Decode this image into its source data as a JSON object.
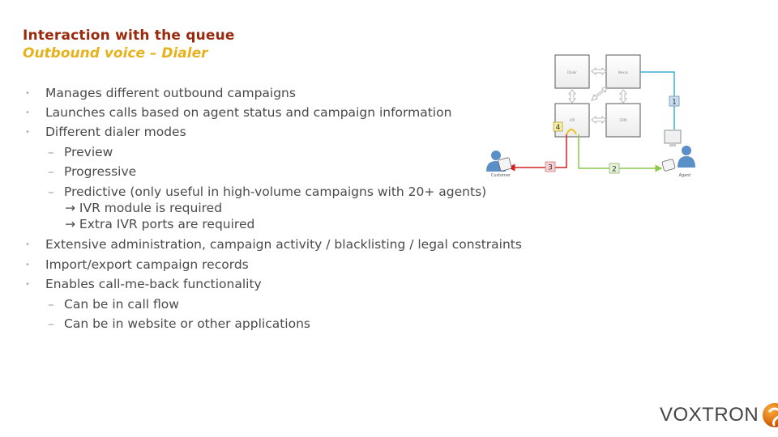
{
  "slide": {
    "title": "Interaction with the queue",
    "subtitle": "Outbound voice – Dialer"
  },
  "bullets": [
    {
      "level": 1,
      "text": "Manages different outbound campaigns"
    },
    {
      "level": 1,
      "text": "Launches calls based on agent status and campaign information"
    },
    {
      "level": 1,
      "text": "Different dialer modes"
    },
    {
      "level": 2,
      "text": "Preview"
    },
    {
      "level": 2,
      "text": "Progressive"
    },
    {
      "level": 2,
      "text": "Predictive (only useful in high-volume campaigns with 20+ agents)"
    },
    {
      "level": 3,
      "text": "→ IVR module is required"
    },
    {
      "level": 3,
      "text": "→ Extra IVR ports are required"
    },
    {
      "level": 1,
      "text": "Extensive administration, campaign activity  / blacklisting / legal constraints"
    },
    {
      "level": 1,
      "text": "Import/export campaign records"
    },
    {
      "level": 1,
      "text": "Enables call-me-back functionality"
    },
    {
      "level": 2,
      "text": "Can be in call flow"
    },
    {
      "level": 2,
      "text": "Can be in website or other applications"
    }
  ],
  "bullet_glyph": "•",
  "dash_glyph": "–",
  "diagram": {
    "boxes": [
      "Dialer",
      "Nexus",
      "IVR",
      "CRM"
    ],
    "steps": [
      "1",
      "2",
      "3",
      "4"
    ],
    "customer_label": "Customer",
    "agent_label": "Agent",
    "colors": {
      "step1": "#3ab0d8",
      "step2": "#8cc84b",
      "step3": "#d42020",
      "step4": "#f0c020"
    }
  },
  "logo": {
    "text": "VOXTRON",
    "icon": "voxtron-swirl-icon"
  },
  "colors": {
    "title": "#9a2a0e",
    "subtitle": "#e6b21c",
    "body_text": "#4a4a4a"
  }
}
